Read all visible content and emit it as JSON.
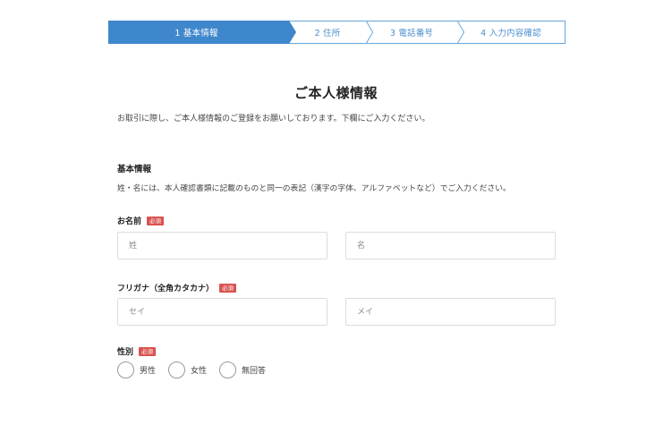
{
  "steps": [
    {
      "label": "1 基本情報",
      "active": true
    },
    {
      "label": "2 住所",
      "active": false
    },
    {
      "label": "3 電話番号",
      "active": false
    },
    {
      "label": "4 入力内容確認",
      "active": false
    }
  ],
  "page": {
    "title": "ご本人様情報",
    "intro": "お取引に際し、ご本人様情報のご登録をお願いしております。下欄にご入力ください。"
  },
  "section": {
    "title": "基本情報",
    "note": "姓・名には、本人確認書類に記載のものと同一の表記（漢字の字体、アルファベットなど）でご入力ください。"
  },
  "fields": {
    "name": {
      "label": "お名前",
      "badge": "必須",
      "last_placeholder": "姓",
      "first_placeholder": "名",
      "last_value": "",
      "first_value": ""
    },
    "kana": {
      "label": "フリガナ（全角カタカナ）",
      "badge": "必須",
      "last_placeholder": "セイ",
      "first_placeholder": "メイ",
      "last_value": "",
      "first_value": ""
    },
    "gender": {
      "label": "性別",
      "badge": "必須",
      "options": [
        "男性",
        "女性",
        "無回答"
      ]
    }
  },
  "colors": {
    "accent": "#3f87cc",
    "required_badge": "#d9534f"
  }
}
